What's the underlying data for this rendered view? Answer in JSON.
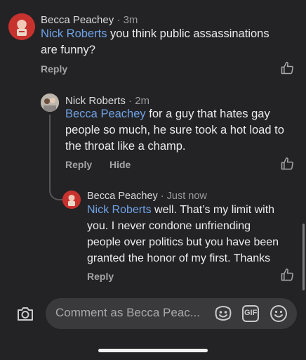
{
  "comments": [
    {
      "author": "Becca Peachey",
      "time": "3m",
      "mention": "Nick Roberts",
      "lines": [
        "you think public assassinations",
        "are funny?"
      ],
      "actions": [
        "Reply"
      ]
    },
    {
      "author": "Nick Roberts",
      "time": "2m",
      "mention": "Becca Peachey",
      "lines": [
        "for a guy that hates gay",
        "people so much, he sure took a hot load to",
        "the throat like a champ."
      ],
      "actions": [
        "Reply",
        "Hide"
      ]
    },
    {
      "author": "Becca Peachey",
      "time": "Just now",
      "mention": "Nick Roberts",
      "lines": [
        "well. That’s my limit with",
        "you. I never condone unfriending",
        "people over politics but you have been",
        "granted the honor of my first. Thanks"
      ],
      "actions": [
        "Reply"
      ]
    }
  ],
  "composer": {
    "placeholder": "Comment as Becca Peac...",
    "gif_label": "GIF"
  },
  "icons": {
    "like": "thumbs-up-outline-icon",
    "camera": "camera-icon",
    "sticker": "sticker-smile-icon",
    "gif": "gif-icon",
    "emoji": "emoji-smile-icon"
  },
  "colors": {
    "background": "#232325",
    "mention": "#6fa2e6",
    "secondary_text": "#9a9a9e"
  }
}
